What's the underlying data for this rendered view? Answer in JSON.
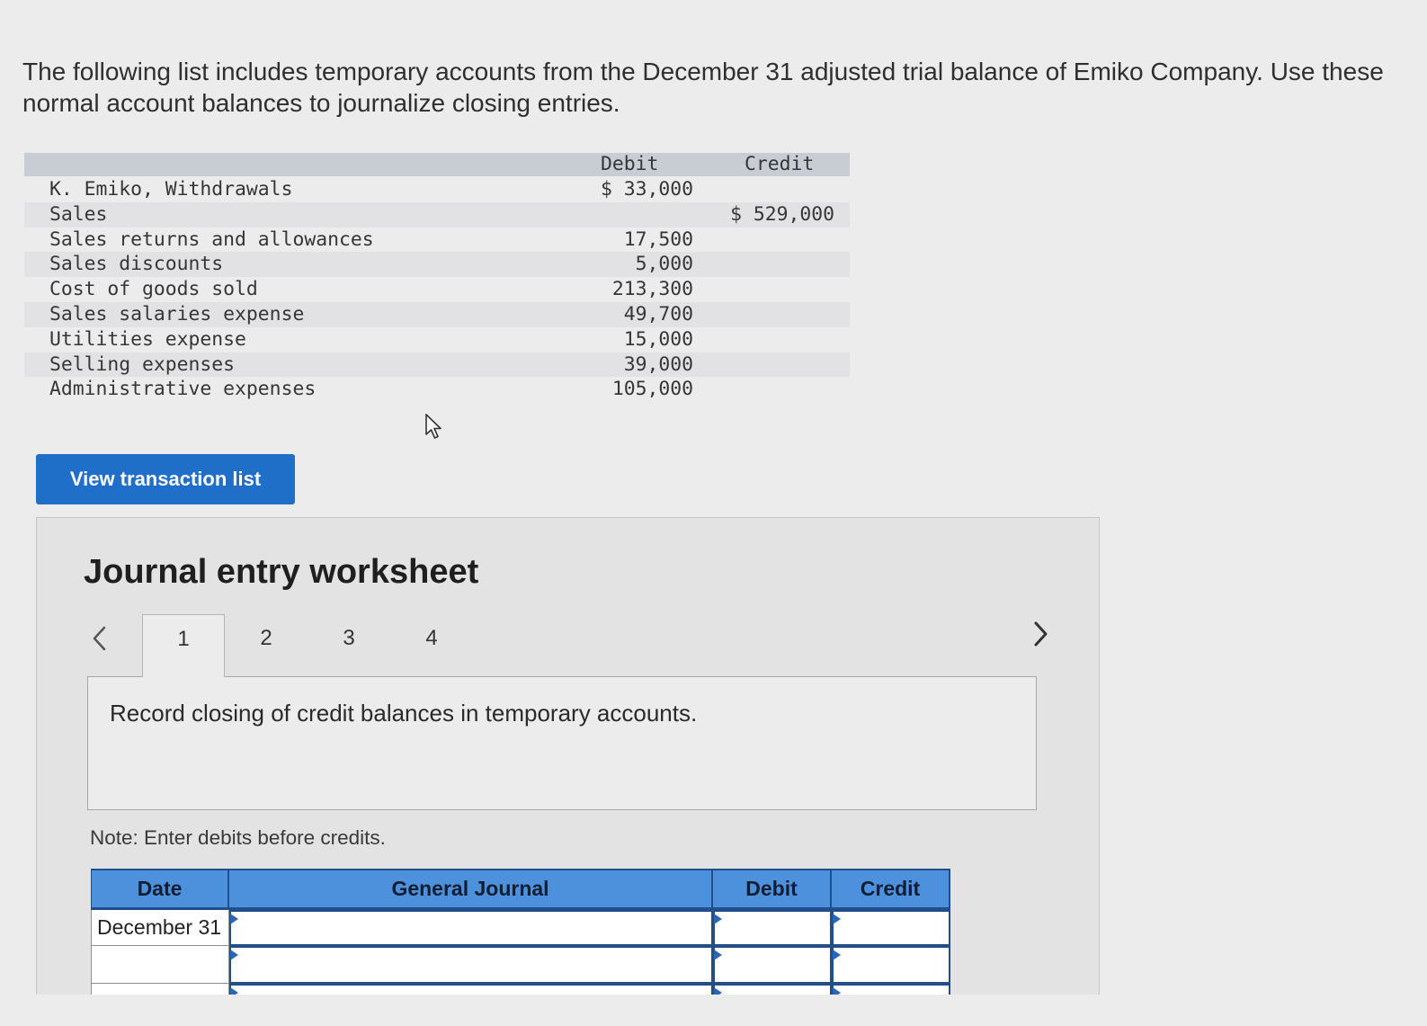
{
  "problem": {
    "statement": "The following list includes temporary accounts from the December 31 adjusted trial balance of Emiko Company. Use these normal account balances to journalize closing entries."
  },
  "trial_balance": {
    "headers": {
      "debit": "Debit",
      "credit": "Credit"
    },
    "rows": [
      {
        "account": "K. Emiko, Withdrawals",
        "debit": "$ 33,000",
        "credit": ""
      },
      {
        "account": "Sales",
        "debit": "",
        "credit": "$ 529,000"
      },
      {
        "account": "Sales returns and allowances",
        "debit": "17,500",
        "credit": ""
      },
      {
        "account": "Sales discounts",
        "debit": "5,000",
        "credit": ""
      },
      {
        "account": "Cost of goods sold",
        "debit": "213,300",
        "credit": ""
      },
      {
        "account": "Sales salaries expense",
        "debit": "49,700",
        "credit": ""
      },
      {
        "account": "Utilities expense",
        "debit": "15,000",
        "credit": ""
      },
      {
        "account": "Selling expenses",
        "debit": "39,000",
        "credit": ""
      },
      {
        "account": "Administrative expenses",
        "debit": "105,000",
        "credit": ""
      }
    ]
  },
  "actions": {
    "view_transaction_list": "View transaction list"
  },
  "worksheet": {
    "title": "Journal entry worksheet",
    "tabs": [
      {
        "label": "1",
        "active": true
      },
      {
        "label": "2",
        "active": false
      },
      {
        "label": "3",
        "active": false
      },
      {
        "label": "4",
        "active": false
      }
    ],
    "prev_icon": "chevron-left-icon",
    "next_icon": "chevron-right-icon",
    "instruction": "Record closing of credit balances in temporary accounts.",
    "note": "Note: Enter debits before credits.",
    "journal": {
      "headers": {
        "date": "Date",
        "account": "General Journal",
        "debit": "Debit",
        "credit": "Credit"
      },
      "rows": [
        {
          "date": "December 31",
          "account": "",
          "debit": "",
          "credit": ""
        },
        {
          "date": "",
          "account": "",
          "debit": "",
          "credit": ""
        },
        {
          "date": "",
          "account": "",
          "debit": "",
          "credit": ""
        }
      ]
    }
  },
  "icons": {
    "pointer": "mouse-pointer-icon",
    "cell_flag": "cell-flag-icon"
  },
  "colors": {
    "button": "#1f6fc8",
    "journal_header": "#4d90dc",
    "journal_border": "#1f4f8c",
    "trial_balance_header": "#c8ccd3"
  }
}
